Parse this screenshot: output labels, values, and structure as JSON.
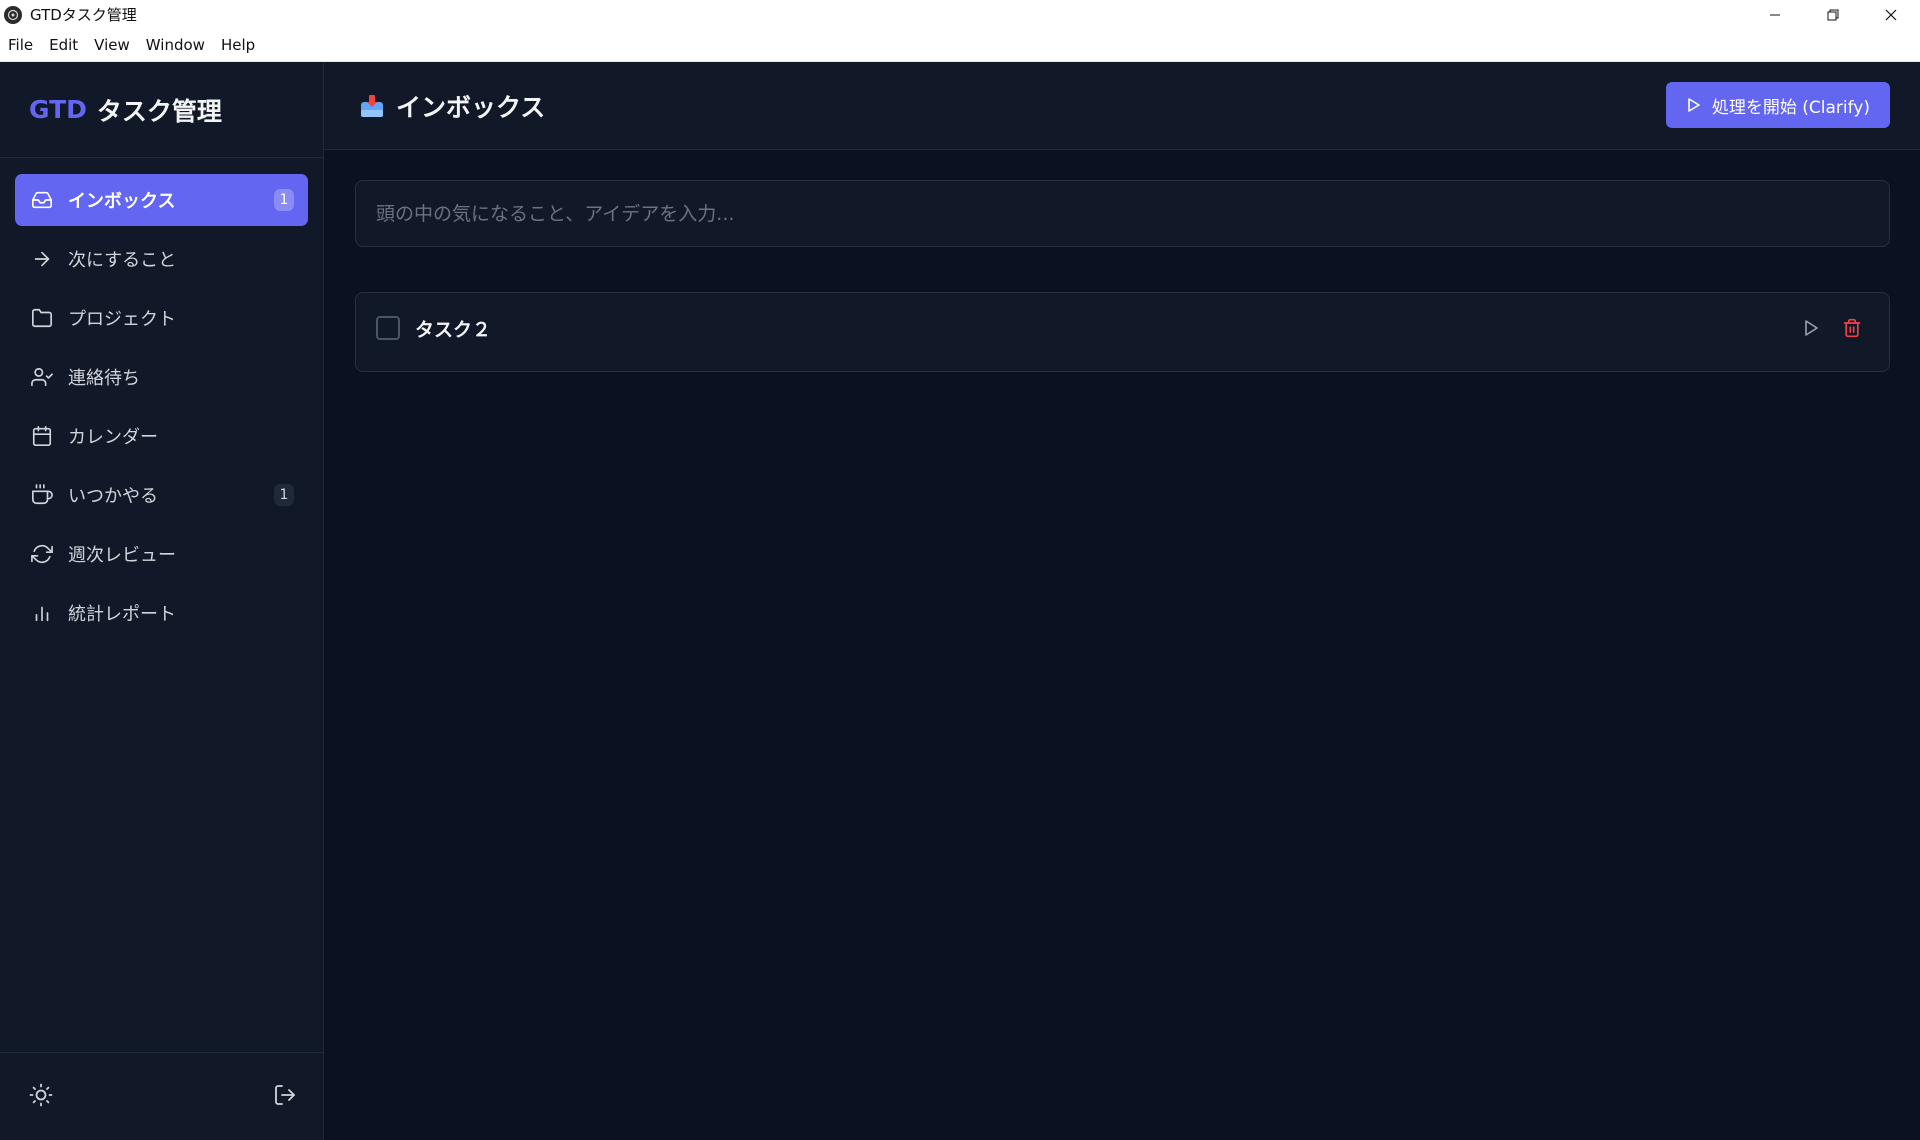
{
  "window": {
    "title": "GTDタスク管理"
  },
  "menu": {
    "items": [
      "File",
      "Edit",
      "View",
      "Window",
      "Help"
    ]
  },
  "brand": {
    "prefix": "GTD",
    "name": "タスク管理"
  },
  "sidebar": {
    "items": [
      {
        "label": "インボックス",
        "icon": "inbox-icon",
        "badge": "1",
        "active": true
      },
      {
        "label": "次にすること",
        "icon": "arrow-right-icon",
        "badge": ""
      },
      {
        "label": "プロジェクト",
        "icon": "folder-icon",
        "badge": ""
      },
      {
        "label": "連絡待ち",
        "icon": "user-check-icon",
        "badge": ""
      },
      {
        "label": "カレンダー",
        "icon": "calendar-icon",
        "badge": ""
      },
      {
        "label": "いつかやる",
        "icon": "coffee-icon",
        "badge": "1"
      },
      {
        "label": "週次レビュー",
        "icon": "refresh-icon",
        "badge": ""
      },
      {
        "label": "統計レポート",
        "icon": "bar-chart-icon",
        "badge": ""
      }
    ]
  },
  "footer": {
    "theme_icon": "sun-icon",
    "logout_icon": "logout-icon"
  },
  "header": {
    "icon": "inbox-tray-emoji",
    "title": "インボックス",
    "clarify_label": "処理を開始 (Clarify)"
  },
  "capture": {
    "placeholder": "頭の中の気になること、アイデアを入力...",
    "value": ""
  },
  "tasks": [
    {
      "title": "タスク２"
    }
  ],
  "colors": {
    "accent": "#6366f1",
    "background": "#0b1120",
    "sidebar": "#111827",
    "danger": "#ef4444"
  }
}
